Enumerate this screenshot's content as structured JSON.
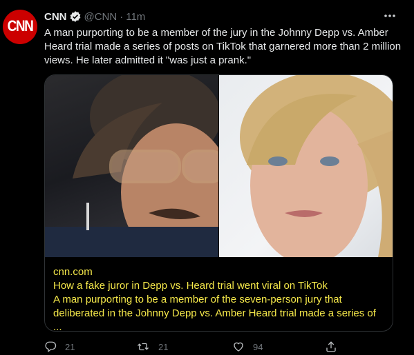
{
  "tweet": {
    "avatar_text": "CNN",
    "name": "CNN",
    "handle": "@CNN",
    "separator": "·",
    "time": "11m",
    "text": "A man purporting to be a member of the jury in the Johnny Depp vs. Amber Heard trial made a series of posts on TikTok that garnered more than 2 million views. He later admitted it \"was just a prank.\""
  },
  "card": {
    "domain": "cnn.com",
    "title": "How a fake juror in Depp vs. Heard trial went viral on TikTok",
    "description": "A man purporting to be a member of the seven-person jury that deliberated in the Johnny Depp vs. Amber Heard trial made a series of ...",
    "image_left": "photo-man-with-glasses",
    "image_right": "photo-woman-blonde"
  },
  "actions": {
    "reply_count": "21",
    "retweet_count": "21",
    "like_count": "94"
  },
  "icons": {
    "more": "more-icon",
    "verified": "verified-badge-icon",
    "reply": "reply-icon",
    "retweet": "retweet-icon",
    "like": "like-icon",
    "share": "share-icon"
  },
  "colors": {
    "background": "#000000",
    "text": "#e7e9ea",
    "muted": "#71767b",
    "card_text": "#f5e84a",
    "brand": "#cc0000"
  }
}
